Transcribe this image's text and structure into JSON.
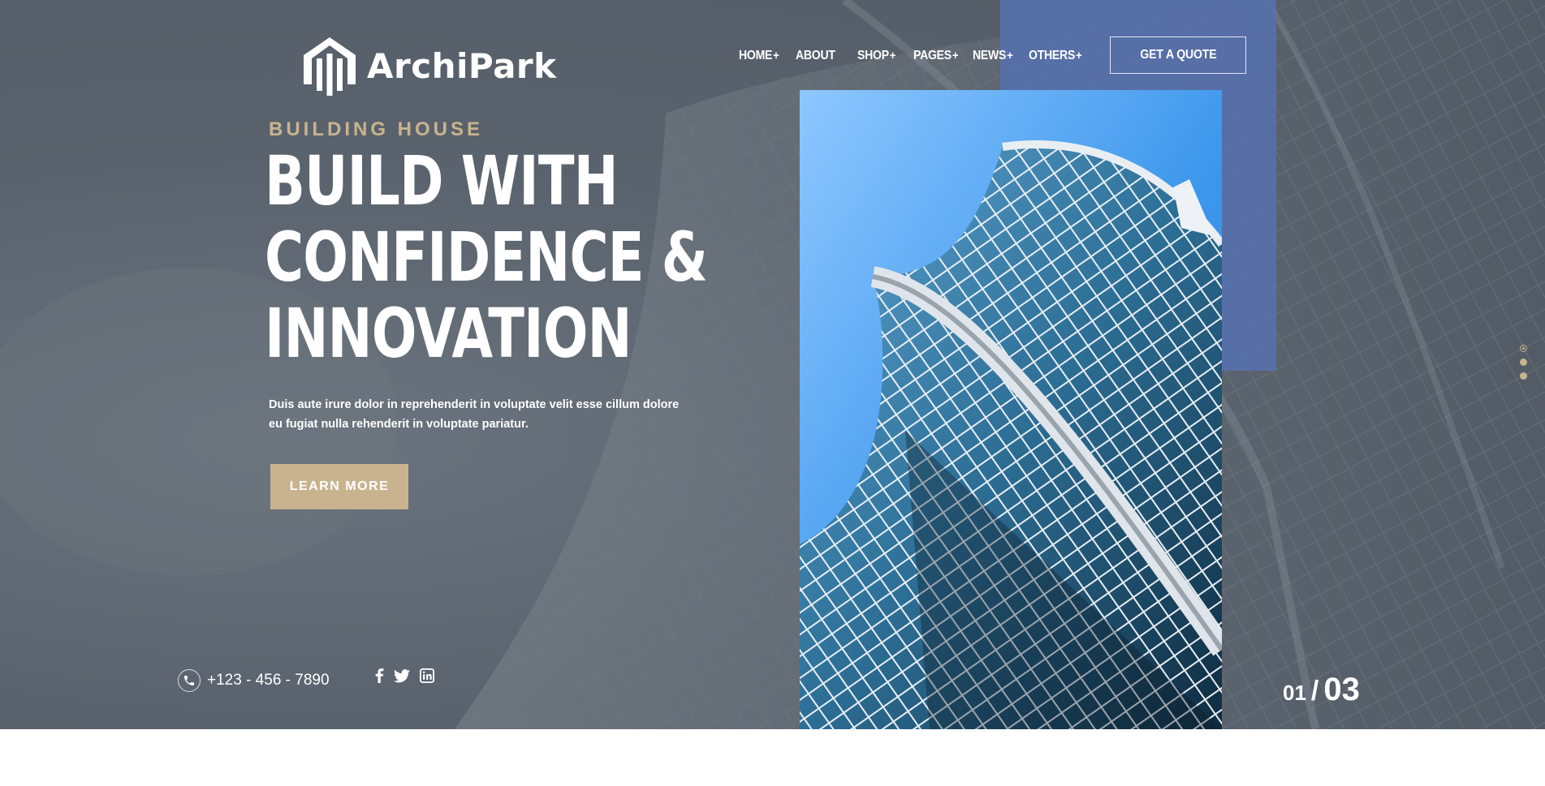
{
  "brand": {
    "name": "ArchiPark"
  },
  "nav": {
    "items": [
      {
        "label": "HOME",
        "has_submenu": true
      },
      {
        "label": "ABOUT",
        "has_submenu": false
      },
      {
        "label": "SHOP",
        "has_submenu": true
      },
      {
        "label": "PAGES",
        "has_submenu": true
      },
      {
        "label": "NEWS",
        "has_submenu": true
      },
      {
        "label": "OTHERS",
        "has_submenu": true
      }
    ],
    "submenu_marker": "+",
    "cta_label": "GET A QUOTE"
  },
  "hero": {
    "eyebrow": "BUILDING HOUSE",
    "headline_lines": [
      "BUILD WITH",
      "CONFIDENCE &",
      "INNOVATION"
    ],
    "description": "Duis aute irure dolor in reprehenderit in voluptate velit esse cillum dolore eu fugiat nulla rehenderit in voluptate pariatur.",
    "button_label": "LEARN MORE"
  },
  "contact": {
    "phone": "+123 - 456 - 7890"
  },
  "social": [
    "facebook-icon",
    "twitter-icon",
    "linkedin-icon"
  ],
  "slider": {
    "current": "01",
    "separator": "/",
    "total": "03",
    "dots": 3,
    "active_index": 0
  },
  "colors": {
    "accent": "#c9b38f",
    "panel_blue": "#5670ad",
    "overlay": "#5a636d",
    "text": "#ffffff"
  }
}
